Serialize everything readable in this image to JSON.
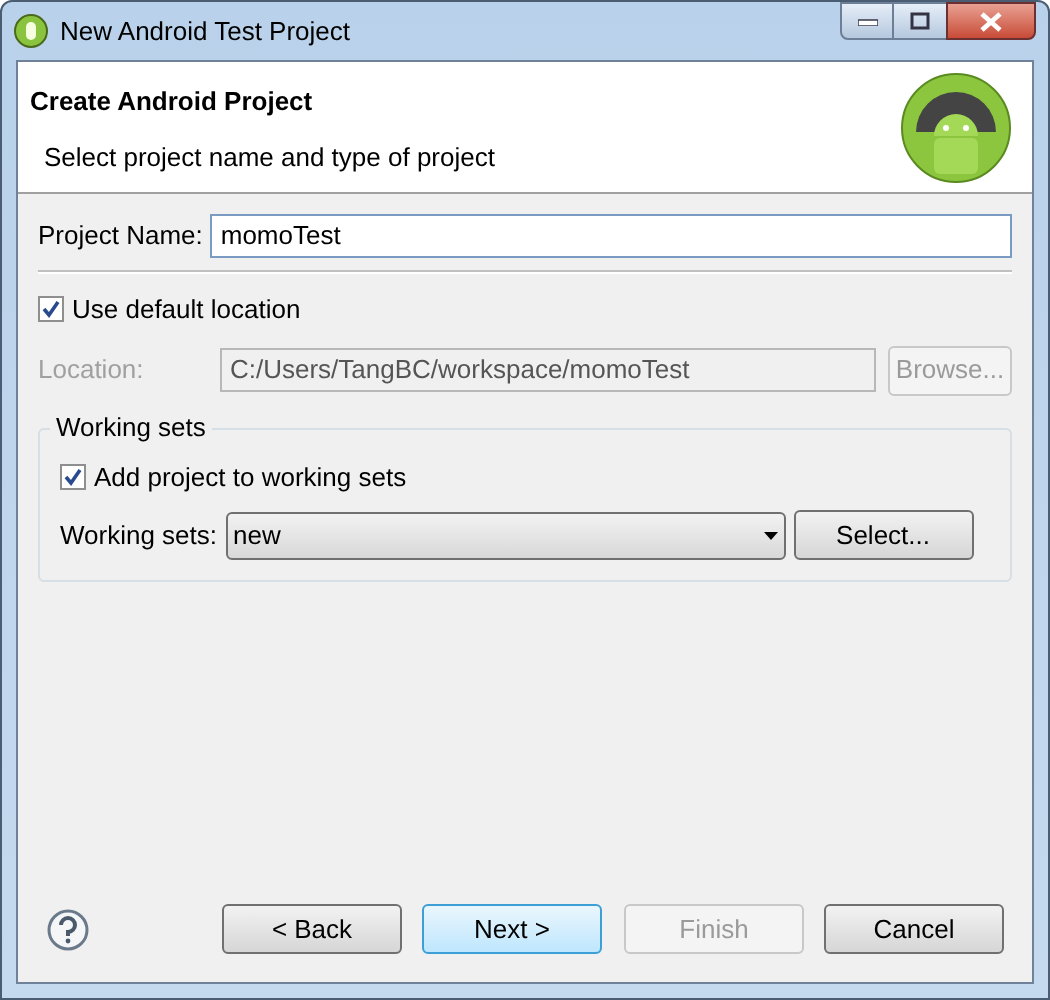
{
  "window": {
    "title": "New Android Test Project"
  },
  "header": {
    "title": "Create Android Project",
    "subtitle": "Select project name and type of project"
  },
  "project_name": {
    "label": "Project Name:",
    "value": "momoTest"
  },
  "use_default_location": {
    "label": "Use default location",
    "checked": true
  },
  "location": {
    "label": "Location:",
    "value": "C:/Users/TangBC/workspace/momoTest",
    "disabled": true,
    "browse": {
      "label": "Browse...",
      "disabled": true
    }
  },
  "working_sets": {
    "title": "Working sets",
    "add": {
      "label": "Add project to working sets",
      "checked": true
    },
    "label": "Working sets:",
    "value": "new",
    "select": {
      "label": "Select...",
      "disabled": false
    }
  },
  "buttons": [
    {
      "label": "< Back",
      "disabled": false,
      "focused": false
    },
    {
      "label": "Next >",
      "disabled": false,
      "focused": true
    },
    {
      "label": "Finish",
      "disabled": true,
      "focused": false
    },
    {
      "label": "Cancel",
      "disabled": false,
      "focused": false
    }
  ]
}
